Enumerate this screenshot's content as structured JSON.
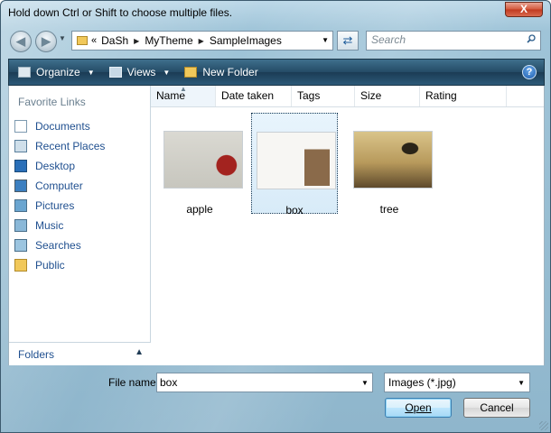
{
  "window": {
    "title": "Hold down Ctrl or Shift to choose multiple files."
  },
  "titlebar": {
    "close_label": "X"
  },
  "address": {
    "chevron": "«",
    "path": [
      "DaSh",
      "MyTheme",
      "SampleImages"
    ]
  },
  "search": {
    "placeholder": "Search"
  },
  "toolbar": {
    "organize_label": "Organize",
    "views_label": "Views",
    "new_folder_label": "New Folder",
    "help_label": "?"
  },
  "nav": {
    "header": "Favorite Links",
    "items": [
      {
        "label": "Documents",
        "icon": "documents-icon"
      },
      {
        "label": "Recent Places",
        "icon": "recent-places-icon"
      },
      {
        "label": "Desktop",
        "icon": "desktop-icon"
      },
      {
        "label": "Computer",
        "icon": "computer-icon"
      },
      {
        "label": "Pictures",
        "icon": "pictures-icon"
      },
      {
        "label": "Music",
        "icon": "music-icon"
      },
      {
        "label": "Searches",
        "icon": "searches-icon"
      },
      {
        "label": "Public",
        "icon": "public-folder-icon"
      }
    ],
    "folders_label": "Folders"
  },
  "columns": [
    "Name",
    "Date taken",
    "Tags",
    "Size",
    "Rating"
  ],
  "files": [
    {
      "name": "apple",
      "selected": false
    },
    {
      "name": "box",
      "selected": true
    },
    {
      "name": "tree",
      "selected": false
    }
  ],
  "filename": {
    "label": "File name:",
    "value": "box"
  },
  "filetype": {
    "selected": "Images (*.jpg)"
  },
  "buttons": {
    "open": "Open",
    "cancel": "Cancel"
  },
  "colors": {
    "toolbar": "#244b66",
    "link": "#1f4f8f",
    "close": "#c0391f"
  }
}
